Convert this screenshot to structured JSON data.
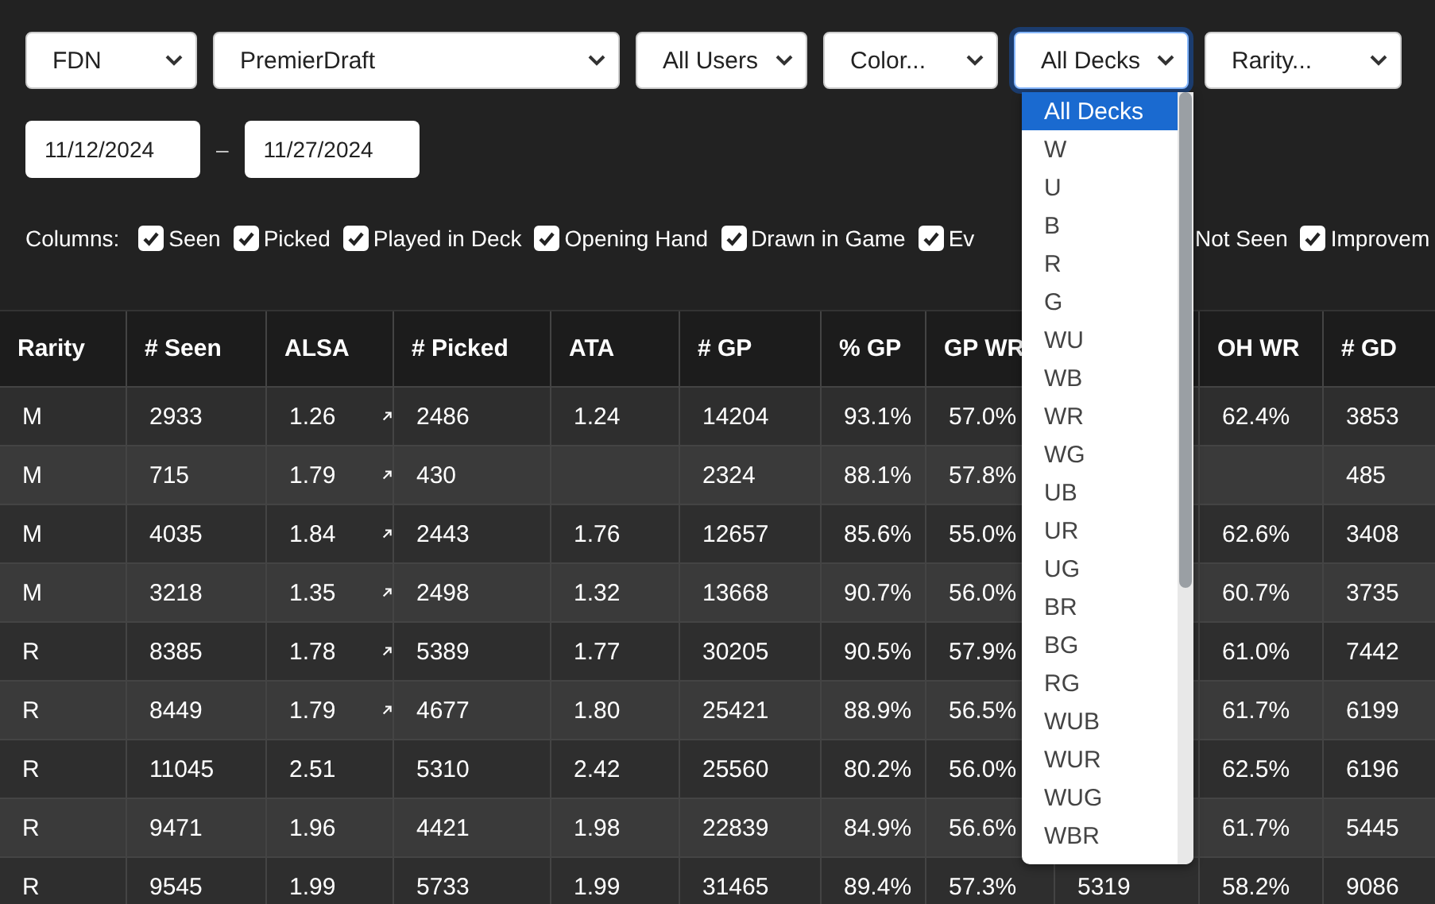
{
  "filters": [
    {
      "value": "FDN",
      "focused": false
    },
    {
      "value": "PremierDraft",
      "focused": false
    },
    {
      "value": "All Users",
      "focused": false
    },
    {
      "value": "Color...",
      "focused": false
    },
    {
      "value": "All Decks",
      "focused": true
    },
    {
      "value": "Rarity...",
      "focused": false
    }
  ],
  "dates": {
    "start": "11/12/2024",
    "separator": "–",
    "end": "11/27/2024"
  },
  "columns_toggle": {
    "label": "Columns:",
    "items": [
      {
        "label": "Seen",
        "checked": true
      },
      {
        "label": "Picked",
        "checked": true
      },
      {
        "label": "Played in Deck",
        "checked": true
      },
      {
        "label": "Opening Hand",
        "checked": true
      },
      {
        "label": "Drawn in Game",
        "checked": true
      },
      {
        "label": "Ev",
        "checked": true
      }
    ],
    "items_after_menu": [
      {
        "label": "Not Seen"
      },
      {
        "label": "Improvem",
        "checked": true
      }
    ]
  },
  "table": {
    "columns": [
      "Rarity",
      "# Seen",
      "ALSA",
      "# Picked",
      "ATA",
      "# GP",
      "% GP",
      "GP WR",
      null,
      "OH WR",
      "# GD"
    ],
    "rows": [
      {
        "trend": true,
        "cells": [
          "M",
          "2933",
          "1.26",
          "2486",
          "1.24",
          "14204",
          "93.1%",
          "57.0%",
          null,
          "62.4%",
          "3853"
        ]
      },
      {
        "trend": true,
        "cells": [
          "M",
          "715",
          "1.79",
          "430",
          null,
          "2324",
          "88.1%",
          "57.8%",
          null,
          null,
          "485"
        ]
      },
      {
        "trend": true,
        "cells": [
          "M",
          "4035",
          "1.84",
          "2443",
          "1.76",
          "12657",
          "85.6%",
          "55.0%",
          null,
          "62.6%",
          "3408"
        ]
      },
      {
        "trend": true,
        "cells": [
          "M",
          "3218",
          "1.35",
          "2498",
          "1.32",
          "13668",
          "90.7%",
          "56.0%",
          null,
          "60.7%",
          "3735"
        ]
      },
      {
        "trend": true,
        "cells": [
          "R",
          "8385",
          "1.78",
          "5389",
          "1.77",
          "30205",
          "90.5%",
          "57.9%",
          null,
          "61.0%",
          "7442"
        ]
      },
      {
        "trend": true,
        "cells": [
          "R",
          "8449",
          "1.79",
          "4677",
          "1.80",
          "25421",
          "88.9%",
          "56.5%",
          null,
          "61.7%",
          "6199"
        ]
      },
      {
        "trend": false,
        "cells": [
          "R",
          "11045",
          "2.51",
          "5310",
          "2.42",
          "25560",
          "80.2%",
          "56.0%",
          null,
          "62.5%",
          "6196"
        ]
      },
      {
        "trend": false,
        "cells": [
          "R",
          "9471",
          "1.96",
          "4421",
          "1.98",
          "22839",
          "84.9%",
          "56.6%",
          null,
          "61.7%",
          "5445"
        ]
      },
      {
        "trend": false,
        "cells": [
          "R",
          "9545",
          "1.99",
          "5733",
          "1.99",
          "31465",
          "89.4%",
          "57.3%",
          "5319",
          "58.2%",
          "9086"
        ]
      }
    ]
  },
  "deck_menu": {
    "options": [
      {
        "label": "All Decks",
        "selected": true
      },
      {
        "label": "W",
        "selected": false
      },
      {
        "label": "U",
        "selected": false
      },
      {
        "label": "B",
        "selected": false
      },
      {
        "label": "R",
        "selected": false
      },
      {
        "label": "G",
        "selected": false
      },
      {
        "label": "WU",
        "selected": false
      },
      {
        "label": "WB",
        "selected": false
      },
      {
        "label": "WR",
        "selected": false
      },
      {
        "label": "WG",
        "selected": false
      },
      {
        "label": "UB",
        "selected": false
      },
      {
        "label": "UR",
        "selected": false
      },
      {
        "label": "UG",
        "selected": false
      },
      {
        "label": "BR",
        "selected": false
      },
      {
        "label": "BG",
        "selected": false
      },
      {
        "label": "RG",
        "selected": false
      },
      {
        "label": "WUB",
        "selected": false
      },
      {
        "label": "WUR",
        "selected": false
      },
      {
        "label": "WUG",
        "selected": false
      },
      {
        "label": "WBR",
        "selected": false
      }
    ]
  }
}
